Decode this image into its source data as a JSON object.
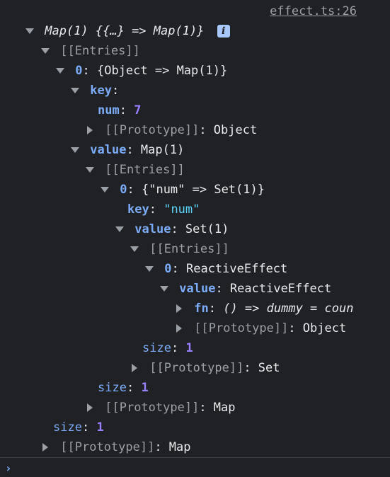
{
  "source_link": "effect.ts:26",
  "info_icon_glyph": "i",
  "prompt_glyph": "›",
  "colors": {
    "background": "#202124",
    "key": "#7cacf8",
    "number": "#9980ff",
    "string": "#5cd5fb",
    "muted": "#9aa0a6",
    "text": "#e8eaed"
  },
  "tree": {
    "root": {
      "label": "Map(1) {{…} => Map(1)}"
    },
    "entries1": {
      "label": "[[Entries]]"
    },
    "e0": {
      "key": "0",
      "value": "{Object => Map(1)}"
    },
    "key_node": {
      "key": "key"
    },
    "num": {
      "key": "num",
      "value": "7"
    },
    "proto_object1": {
      "key": "[[Prototype]]",
      "value": "Object"
    },
    "value_node": {
      "key": "value",
      "value": "Map(1)"
    },
    "entries2": {
      "label": "[[Entries]]"
    },
    "e0b": {
      "key": "0",
      "value": "{\"num\" => Set(1)}"
    },
    "key2": {
      "key": "key",
      "value": "\"num\""
    },
    "value2": {
      "key": "value",
      "value": "Set(1)"
    },
    "entries3": {
      "label": "[[Entries]]"
    },
    "e0c": {
      "key": "0",
      "value": "ReactiveEffect"
    },
    "value3": {
      "key": "value",
      "value": "ReactiveEffect"
    },
    "fn": {
      "key": "fn",
      "value": "() => dummy = coun"
    },
    "proto_object2": {
      "key": "[[Prototype]]",
      "value": "Object"
    },
    "size_set": {
      "key": "size",
      "value": "1"
    },
    "proto_set": {
      "key": "[[Prototype]]",
      "value": "Set"
    },
    "size_map_inner": {
      "key": "size",
      "value": "1"
    },
    "proto_map_inner": {
      "key": "[[Prototype]]",
      "value": "Map"
    },
    "size_map_outer": {
      "key": "size",
      "value": "1"
    },
    "proto_map_outer": {
      "key": "[[Prototype]]",
      "value": "Map"
    }
  }
}
